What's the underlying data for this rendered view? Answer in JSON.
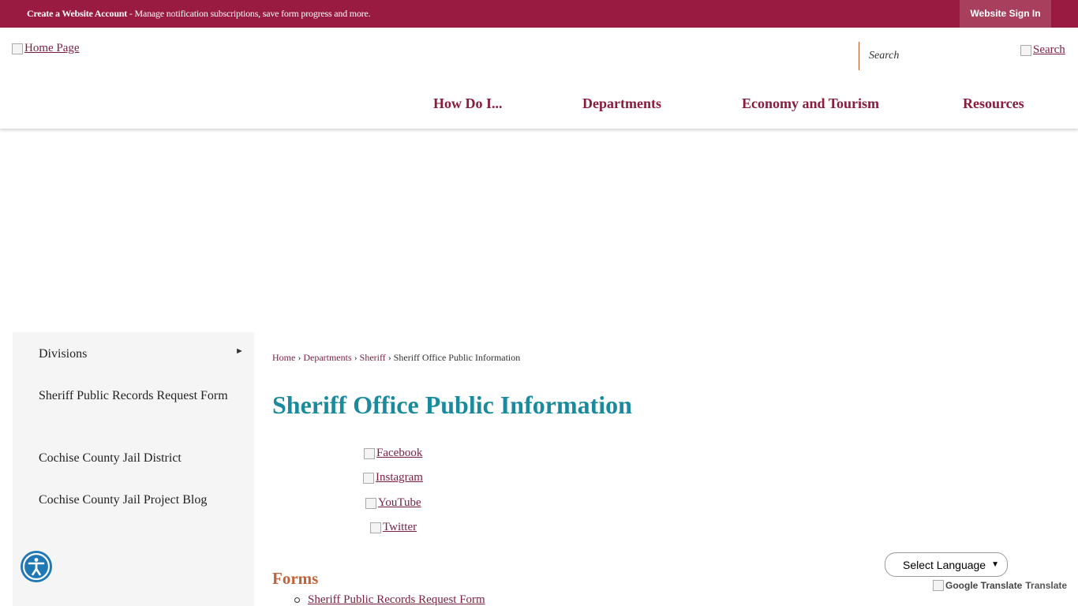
{
  "topbar": {
    "message_bold": "Create a Website Account",
    "message_rest": " - Manage notification subscriptions, save form progress and more.",
    "signin_label": "Website Sign In"
  },
  "header": {
    "logo_alt": "Home Page",
    "search_placeholder": "Search",
    "search_button_alt": "Search",
    "nav": [
      {
        "label": "How Do I..."
      },
      {
        "label": "Departments"
      },
      {
        "label": "Economy and Tourism"
      },
      {
        "label": "Resources"
      }
    ]
  },
  "sidebar": {
    "items": [
      {
        "label": "Divisions"
      },
      {
        "label": "Sheriff Public Records Request Form"
      },
      {
        "label": "Cochise County Jail District"
      },
      {
        "label": "Cochise County Jail Project Blog"
      }
    ],
    "arrow": "►"
  },
  "breadcrumb": {
    "home": "Home",
    "departments": "Departments",
    "sheriff": "Sheriff",
    "current": "Sheriff Office Public Information",
    "separator": "›"
  },
  "main": {
    "title": "Sheriff Office Public Information",
    "social": [
      {
        "label": "Facebook"
      },
      {
        "label": "Instagram"
      },
      {
        "label": "YouTube"
      },
      {
        "label": "Twitter"
      }
    ],
    "forms_heading": "Forms",
    "forms": [
      {
        "label": "Sheriff Public Records Request Form"
      }
    ]
  },
  "translate": {
    "select_label": "Select Language",
    "google_alt": "Google Translate",
    "translate_label": "Translate"
  },
  "colors": {
    "brand": "#991b42",
    "title": "#1a8a9e",
    "link": "#7a1f3a",
    "forms_heading": "#c0633a",
    "accessibility": "#1f77b4"
  }
}
